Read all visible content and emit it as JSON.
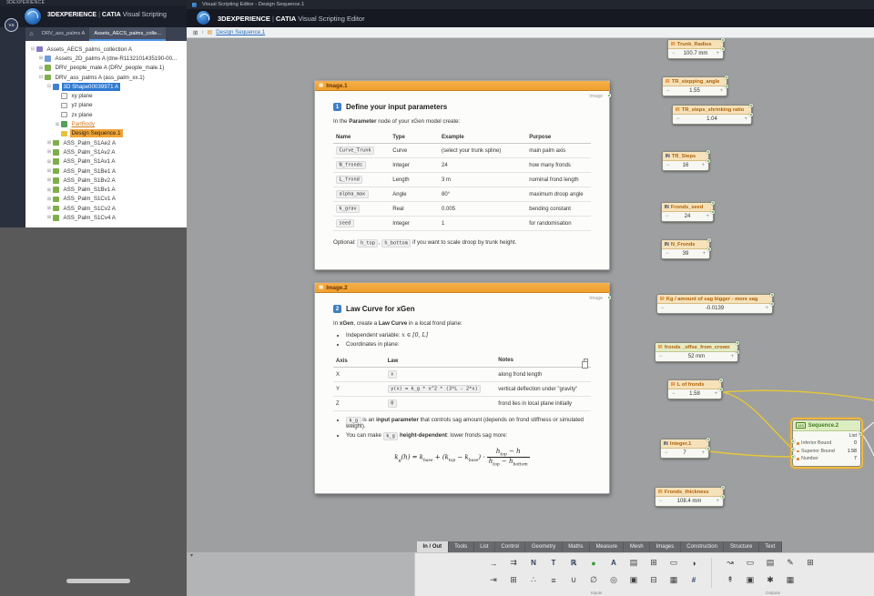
{
  "icons": {
    "home": "⌂",
    "grid": "⊞",
    "chevron": "›",
    "crumb_tree": "▤",
    "minus": "−",
    "plus": "+",
    "collapse": "▾",
    "image": "▦",
    "list_badge": "123"
  },
  "left_window": {
    "titlebar": "3DEXPERIENCE",
    "brand": {
      "app": "3DEXPERIENCE",
      "sep": "|",
      "product_bold": "CATIA",
      "product_rest": " Visual Scripting"
    },
    "avatar": "V.5",
    "tabs": [
      {
        "name": "doc-tab-drv-ass-palms",
        "label": "DRV_ass_palms A",
        "cls": ""
      },
      {
        "name": "doc-tab-assets-aecs-palms",
        "label": "Assets_AECS_palms_colle...",
        "cls": "active"
      }
    ],
    "tree": [
      {
        "cls": "d0",
        "icon": "ic-purple",
        "exp": "⊟",
        "label": "Assets_AECS_palms_collection A"
      },
      {
        "cls": "d1",
        "icon": "ic-blue",
        "exp": "⊞",
        "label": "Assets_2D_palms A (drw-R1132101435190-00..."
      },
      {
        "cls": "d1",
        "icon": "ic-green",
        "exp": "⊞",
        "label": "DRV_people_male A (DRV_people_male.1)"
      },
      {
        "cls": "d1",
        "icon": "ic-green",
        "exp": "⊟",
        "label": "DRV_ass_palms A (ass_palm_xx.1)"
      },
      {
        "cls": "d2",
        "icon": "ic-shape",
        "exp": "⊟",
        "label": "3D Shape00039971 A",
        "state": "selected"
      },
      {
        "cls": "d3",
        "icon": "ic-plane",
        "exp": "",
        "label": "xy plane"
      },
      {
        "cls": "d3",
        "icon": "ic-plane",
        "exp": "",
        "label": "yz plane"
      },
      {
        "cls": "d3",
        "icon": "ic-plane",
        "exp": "",
        "label": "zx plane"
      },
      {
        "cls": "d3",
        "icon": "ic-body",
        "exp": "⊞",
        "label": "PartBody",
        "state": "partbody"
      },
      {
        "cls": "d3",
        "icon": "ic-script",
        "exp": "",
        "label": "Design Sequence.1",
        "state": "orange"
      },
      {
        "cls": "d2",
        "icon": "ic-green",
        "exp": "⊞",
        "label": "ASS_Palm_S1Ae2 A"
      },
      {
        "cls": "d2",
        "icon": "ic-green",
        "exp": "⊞",
        "label": "ASS_Palm_S1Av2 A"
      },
      {
        "cls": "d2",
        "icon": "ic-green",
        "exp": "⊞",
        "label": "ASS_Palm_S1Av1 A"
      },
      {
        "cls": "d2",
        "icon": "ic-green",
        "exp": "⊞",
        "label": "ASS_Palm_S1Be1 A"
      },
      {
        "cls": "d2",
        "icon": "ic-green",
        "exp": "⊞",
        "label": "ASS_Palm_S1Bv2 A"
      },
      {
        "cls": "d2",
        "icon": "ic-green",
        "exp": "⊞",
        "label": "ASS_Palm_S1Bv1 A"
      },
      {
        "cls": "d2",
        "icon": "ic-green",
        "exp": "⊞",
        "label": "ASS_Palm_S1Cv1 A"
      },
      {
        "cls": "d2",
        "icon": "ic-green",
        "exp": "⊞",
        "label": "ASS_Palm_S1Cv2 A"
      },
      {
        "cls": "d2",
        "icon": "ic-green",
        "exp": "⊞",
        "label": "ASS_Palm_S1Cv4 A"
      }
    ]
  },
  "editor": {
    "titlebar": "Visual Scripting Editor - Design Sequence.1",
    "brand": {
      "app": "3DEXPERIENCE",
      "sep": "|",
      "product_bold": "CATIA",
      "product_rest": " Visual Scripting Editor"
    },
    "breadcrumb": {
      "link": "Design Sequence.1"
    },
    "card1": {
      "header": "Image.1",
      "tag": "Image",
      "num": "1",
      "title": "Define your input parameters",
      "intro": {
        "a": "In the ",
        "b": "Parameter",
        "c": " node of your xGen model create:"
      },
      "columns": [
        "Name",
        "Type",
        "Example",
        "Purpose"
      ],
      "rows": [
        {
          "name": "Curve_Trunk",
          "type": "Curve",
          "example": "(select your trunk spline)",
          "purpose": "main palm axis"
        },
        {
          "name": "N_fronds",
          "type": "Integer",
          "example": "24",
          "purpose": "how many fronds"
        },
        {
          "name": "L_frond",
          "type": "Length",
          "example": "3 m",
          "purpose": "nominal frond length"
        },
        {
          "name": "alpha_max",
          "type": "Angle",
          "example": "80°",
          "purpose": "maximum droop angle"
        },
        {
          "name": "k_grav",
          "type": "Real",
          "example": "0.005",
          "purpose": "bending constant"
        },
        {
          "name": "seed",
          "type": "Integer",
          "example": "1",
          "purpose": "for randomisation"
        }
      ],
      "optional": {
        "a": "Optional: ",
        "code1": "h_top",
        "sep": ", ",
        "code2": "h_bottom",
        "b": " if you want to scale droop by trunk height."
      }
    },
    "card2": {
      "header": "Image.2",
      "tag": "Image",
      "num": "2",
      "title": "Law Curve for xGen",
      "intro": {
        "a": "In ",
        "b": "xGen",
        "c": ", create a ",
        "d": "Law Curve",
        "e": " in a local frond plane:"
      },
      "bullet1": {
        "a": "Independent variable: ",
        "math": "x ∈ [0, L]"
      },
      "bullet2": "Coordinates in plane:",
      "columns": [
        "Axis",
        "Law",
        "Notes"
      ],
      "rows": [
        {
          "axis": "X",
          "law": "x",
          "notes": "along frond length"
        },
        {
          "axis": "Y",
          "law": "y(x) = k_g * x^2 * (3*L - 2*x)",
          "notes": "vertical deflection under \"gravity\""
        },
        {
          "axis": "Z",
          "law": "0",
          "notes": "frond lies in local plane initially"
        }
      ],
      "bullet3": {
        "code": "k_g",
        "a": " is an ",
        "b": "input parameter",
        "c": " that controls sag amount (depends on frond stiffness or simulated weight)."
      },
      "bullet4": {
        "a": "You can make ",
        "code": "k_g",
        "b": " ",
        "c": "height-dependent",
        "d": ": lower fronds sag more:"
      },
      "formula": {
        "f1": "k",
        "f2": "g",
        "f3": "(h) = k",
        "f4": "base",
        "f5": " + (k",
        "f6": "top",
        "f7": " − k",
        "f8": "base",
        "f9": ") · ",
        "n1": "h",
        "n2": "top",
        "n3": " − h",
        "d1": "h",
        "d2": "top",
        "d3": " − h",
        "d4": "bottom"
      }
    },
    "nodes": {
      "trunk_radius": {
        "title": "Trunk_Radius",
        "type": "IR",
        "value": "100.7 mm"
      },
      "tr_stepping_angle": {
        "title": "TR_stepping_angle",
        "type": "IR",
        "value": "1.55"
      },
      "tr_steps_shrinking_ratio": {
        "title": "TR_steps_shrinking ratio",
        "type": "IR",
        "value": "1.04"
      },
      "tr_steps": {
        "title": "TR_Steps",
        "type": "IN",
        "value": "16"
      },
      "fronds_seed": {
        "title": "Fronds_seed",
        "type": "IN",
        "value": "24"
      },
      "n_fronds": {
        "title": "N_Fronds",
        "type": "IN",
        "value": "39"
      },
      "kg_sag": {
        "title": "Kg / amount of sag bigger - more sag",
        "type": "IR",
        "value": "-0.0139"
      },
      "fronds_offset": {
        "title": "fronds _offse_from_crown",
        "type": "IR",
        "value": "52 mm"
      },
      "l_of_fronds": {
        "title": "L of fronds",
        "type": "IR",
        "value": "1.58"
      },
      "integer_1": {
        "title": "Integer.1",
        "type": "IN",
        "value": "7"
      },
      "fronds_thickness": {
        "title": "Fronds_thickness",
        "type": "IR",
        "value": "108.4 mm"
      }
    },
    "sequence": {
      "title": "Sequence.2",
      "output": "List",
      "rows": [
        {
          "label": "Inferior Bound",
          "value": "0"
        },
        {
          "label": "Superior Bound",
          "value": "1.58"
        },
        {
          "label": "Number",
          "value": "7"
        }
      ]
    },
    "tabs": [
      {
        "name": "tab-in-out",
        "label": "In / Out",
        "cls": "active"
      },
      {
        "name": "tab-tools",
        "label": "Tools"
      },
      {
        "name": "tab-list",
        "label": "List"
      },
      {
        "name": "tab-control",
        "label": "Control"
      },
      {
        "name": "tab-geometry",
        "label": "Geometry"
      },
      {
        "name": "tab-maths",
        "label": "Maths"
      },
      {
        "name": "tab-measure",
        "label": "Measure"
      },
      {
        "name": "tab-mesh",
        "label": "Mesh"
      },
      {
        "name": "tab-images",
        "label": "Images"
      },
      {
        "name": "tab-construction",
        "label": "Construction"
      },
      {
        "name": "tab-structure",
        "label": "Structure"
      },
      {
        "name": "tab-text",
        "label": "Text"
      }
    ],
    "palette": {
      "inputs": {
        "caption": "Inputs",
        "row1": [
          {
            "name": "flow-input-icon",
            "glyph": "→"
          },
          {
            "name": "multi-input-icon",
            "glyph": "⇉"
          },
          {
            "name": "integer-input-icon",
            "glyph": "N",
            "cls": "letter"
          },
          {
            "name": "text-input-icon",
            "glyph": "T",
            "cls": "letter"
          },
          {
            "name": "real-input-icon",
            "glyph": "ℝ",
            "cls": "letter"
          },
          {
            "name": "color-input-icon",
            "glyph": "●",
            "cls": "green"
          },
          {
            "name": "annotation-input-icon",
            "glyph": "A",
            "cls": "letter"
          },
          {
            "name": "chart-input-icon",
            "glyph": "▤"
          },
          {
            "name": "table-input-icon",
            "glyph": "⊞"
          },
          {
            "name": "screen-input-icon",
            "glyph": "▭"
          },
          {
            "name": "half-disc-input-icon",
            "glyph": "◑"
          }
        ],
        "row2": [
          {
            "name": "step-input-icon",
            "glyph": "⇥"
          },
          {
            "name": "grid-input-icon",
            "glyph": "⊞"
          },
          {
            "name": "points-input-icon",
            "glyph": "∴"
          },
          {
            "name": "list-input-icon",
            "glyph": "≡"
          },
          {
            "name": "magnet-input-icon",
            "glyph": "∪"
          },
          {
            "name": "null-input-icon",
            "glyph": "∅"
          },
          {
            "name": "target-input-icon",
            "glyph": "◎"
          },
          {
            "name": "image-input-icon",
            "glyph": "▣"
          },
          {
            "name": "minus-table-input-icon",
            "glyph": "⊟"
          },
          {
            "name": "mesh-input-icon",
            "glyph": "▦"
          },
          {
            "name": "hash-input-icon",
            "glyph": "#",
            "cls": "letter"
          }
        ]
      },
      "outputs": {
        "caption": "Outputs",
        "row1": [
          {
            "name": "signal-output-icon",
            "glyph": "↝"
          },
          {
            "name": "monitor-output-icon",
            "glyph": "▭"
          },
          {
            "name": "report-output-icon",
            "glyph": "▤"
          },
          {
            "name": "edit-output-icon",
            "glyph": "✎"
          },
          {
            "name": "table-output-icon",
            "glyph": "⊞"
          }
        ],
        "row2": [
          {
            "name": "export-output-icon",
            "glyph": "↟"
          },
          {
            "name": "display-output-icon",
            "glyph": "▣"
          },
          {
            "name": "process-output-icon",
            "glyph": "✱"
          },
          {
            "name": "mesh-output-icon",
            "glyph": "▦"
          }
        ]
      }
    }
  }
}
